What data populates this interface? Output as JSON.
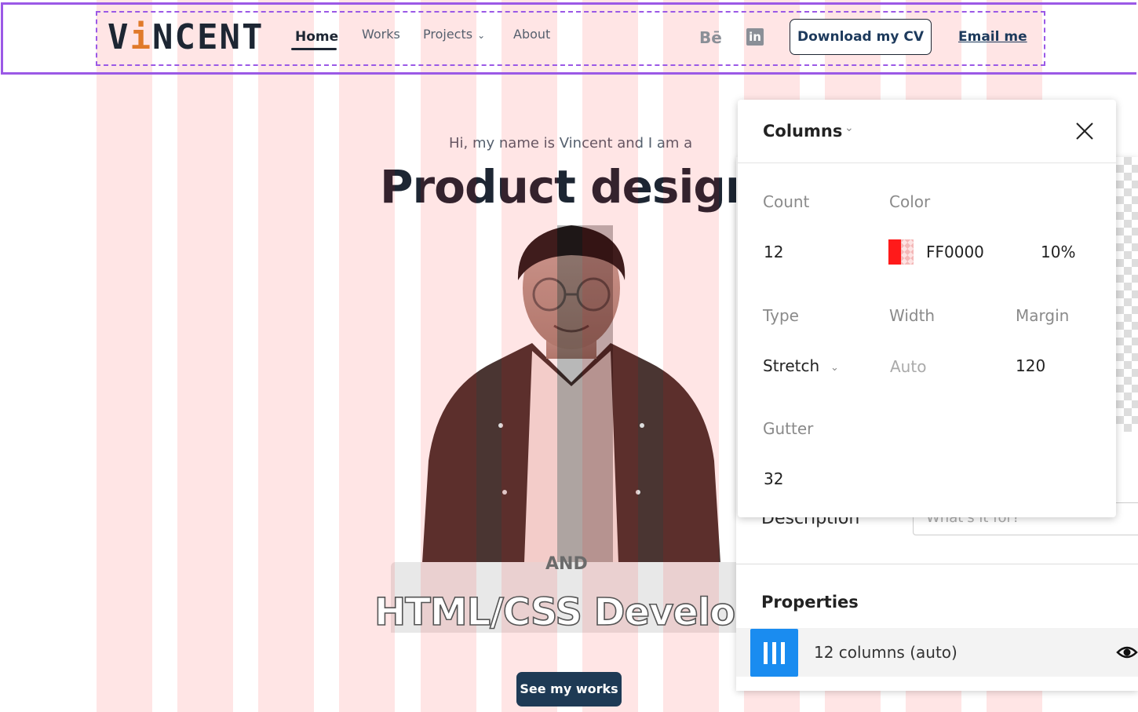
{
  "header": {
    "logo": {
      "prefix": "V",
      "accent": "i",
      "suffix": "NCENT"
    },
    "nav": {
      "home": "Home",
      "works": "Works",
      "projects": "Projects",
      "about": "About"
    },
    "social": {
      "behance": "Bē",
      "linkedin": "in"
    },
    "cv_button": "Download my CV",
    "email_link": "Email me"
  },
  "hero": {
    "intro": "Hi, my name is Vincent and I am a",
    "title": "Product designe",
    "and": "AND",
    "subtitle": "HTML/CSS Develope",
    "cta": "See my works"
  },
  "columns_popover": {
    "title": "Columns",
    "count_label": "Count",
    "count_value": "12",
    "color_label": "Color",
    "color_hex": "FF0000",
    "color_opacity": "10%",
    "type_label": "Type",
    "type_value": "Stretch",
    "width_label": "Width",
    "width_value": "Auto",
    "margin_label": "Margin",
    "margin_value": "120",
    "gutter_label": "Gutter",
    "gutter_value": "32"
  },
  "properties_panel": {
    "description_label": "Description",
    "description_placeholder": "What's it for?",
    "title": "Properties",
    "grid_item_label": "12 columns (auto)"
  },
  "colors": {
    "grid_column": "#ff0000",
    "frame_outline": "#9b59e6",
    "accent_blue": "#1a8cf0",
    "navy": "#1e3a55",
    "logo_accent": "#e07a2a"
  },
  "icons": [
    "chevron-down-icon",
    "behance-icon",
    "linkedin-icon",
    "close-icon",
    "column-grid-icon",
    "eye-icon"
  ]
}
